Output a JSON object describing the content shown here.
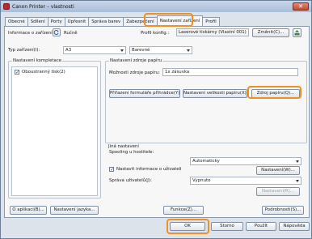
{
  "window": {
    "title": "Canon Printer – vlastnosti",
    "close_label": "✕"
  },
  "tabs": [
    {
      "label": "Obecné"
    },
    {
      "label": "Sdílení"
    },
    {
      "label": "Porty"
    },
    {
      "label": "Upřesnit"
    },
    {
      "label": "Správa barev"
    },
    {
      "label": "Zabezpečení"
    },
    {
      "label": "Nastavení zařízení"
    },
    {
      "label": "Profil"
    }
  ],
  "device_info": {
    "label": "Informace o zařízení:",
    "mode": "Ručně"
  },
  "profile": {
    "label": "Profil konfig.:",
    "value": "Laserové tiskárny (Vlastní 001)",
    "change_button": "Změnit(C)..."
  },
  "device_type": {
    "label": "Typ zařízení(I):",
    "value": "A3",
    "color_value": "Barevné"
  },
  "accessories": {
    "title": "Nastavení kompletace",
    "duplex_label": "Oboustranný tisk(2)",
    "duplex_checked": "✓"
  },
  "paper_source": {
    "title": "Nastavení zdroje papíru",
    "options_label": "Možnosti zdroje papíru:",
    "options_value": "1x zásuvka",
    "assign_button": "Přiřazení formuláře přihrádce(Y)...",
    "custom_size_button": "Nastavení velikosti papíru(X)...",
    "source_button": "Zdroj papíru(Q)..."
  },
  "other": {
    "title": "Jiná nastavení",
    "spooling_label": "Spooling u hostitele:",
    "spooling_value": "Automaticky",
    "user_info_label": "Nastavit informace o uživateli",
    "user_info_checked": "✓",
    "settings_button": "Nastavení(W)...",
    "user_mgmt_label": "Správa uživatelů(J):",
    "user_mgmt_value": "Vypnuto",
    "settings_disabled_button": "Nastavení(R)..."
  },
  "footer": {
    "about_button": "O aplikaci(B)...",
    "language_button": "Nastavení jazyka...",
    "functions_button": "Funkce(Z)...",
    "details_button": "Podrobnosti(S)..."
  },
  "dialog_buttons": {
    "ok": "OK",
    "cancel": "Storno",
    "apply": "Použít",
    "help": "Nápověda"
  }
}
